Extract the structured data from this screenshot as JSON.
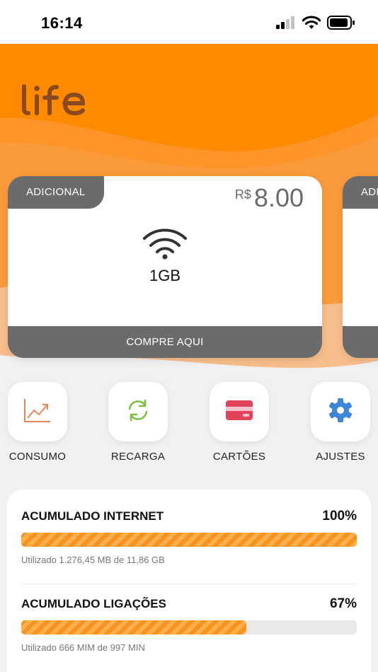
{
  "status_bar": {
    "time": "16:14"
  },
  "brand": {
    "name": "life",
    "color": "#8a4a1f"
  },
  "colors": {
    "orange": "#ff8a00",
    "orange_light": "#f7b27a",
    "gray": "#6b6b6b",
    "stripe": "#f7931e"
  },
  "offers": [
    {
      "tag": "ADICIONAL",
      "currency": "R$",
      "price": "8.00",
      "amount": "1GB",
      "cta": "COMPRE AQUI",
      "icon": "wifi-icon"
    },
    {
      "tag": "ADI"
    }
  ],
  "actions": [
    {
      "label": "CONSUMO",
      "icon": "chart-trend-icon",
      "color": "#e8855a"
    },
    {
      "label": "RECARGA",
      "icon": "refresh-icon",
      "color": "#7ac142"
    },
    {
      "label": "CARTÕES",
      "icon": "credit-card-icon",
      "color": "#e0435a"
    },
    {
      "label": "AJUSTES",
      "icon": "gear-icon",
      "color": "#3d86d8"
    }
  ],
  "usage": [
    {
      "title": "ACUMULADO INTERNET",
      "percent_label": "100%",
      "percent": 100,
      "note": "Utilizado 1.276,45 MB de 11,86 GB"
    },
    {
      "title": "ACUMULADO LIGAÇÕES",
      "percent_label": "67%",
      "percent": 67,
      "note": "Utilizado 666 MIM de 997 MIN"
    }
  ]
}
